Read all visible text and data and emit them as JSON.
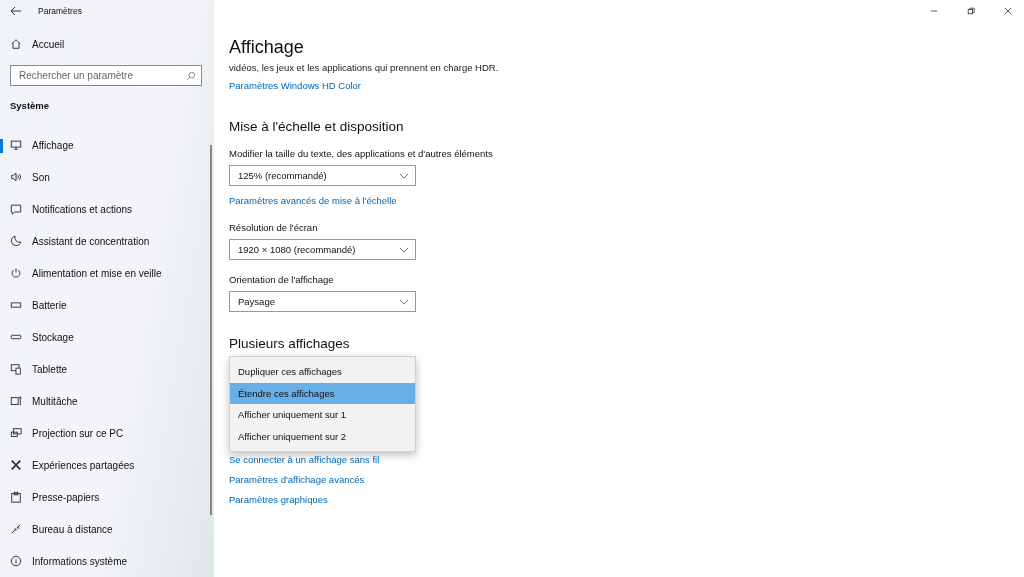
{
  "window": {
    "title": "Paramètres"
  },
  "sidebar": {
    "home": "Accueil",
    "search": {
      "placeholder": "Rechercher un paramètre"
    },
    "section": "Système",
    "items": [
      {
        "label": "Affichage",
        "selected": true
      },
      {
        "label": "Son",
        "selected": false
      },
      {
        "label": "Notifications et actions",
        "selected": false
      },
      {
        "label": "Assistant de concentration",
        "selected": false
      },
      {
        "label": "Alimentation et mise en veille",
        "selected": false
      },
      {
        "label": "Batterie",
        "selected": false
      },
      {
        "label": "Stockage",
        "selected": false
      },
      {
        "label": "Tablette",
        "selected": false
      },
      {
        "label": "Multitâche",
        "selected": false
      },
      {
        "label": "Projection sur ce PC",
        "selected": false
      },
      {
        "label": "Expériences partagées",
        "selected": false
      },
      {
        "label": "Presse-papiers",
        "selected": false
      },
      {
        "label": "Bureau à distance",
        "selected": false
      },
      {
        "label": "Informations système",
        "selected": false
      }
    ]
  },
  "main": {
    "title": "Affichage",
    "hdr_text": "vidéos, les jeux et les applications qui prennent en charge HDR.",
    "hdr_link": "Paramètres Windows HD Color",
    "scale_section": {
      "heading": "Mise à l'échelle et disposition",
      "fields": [
        {
          "label": "Modifier la taille du texte, des applications et d'autres éléments",
          "value": "125% (recommandé)",
          "link": "Paramètres avancés de mise à l'échelle"
        },
        {
          "label": "Résolution de l'écran",
          "value": "1920 × 1080 (recommandé)"
        },
        {
          "label": "Orientation de l'affichage",
          "value": "Paysage"
        }
      ]
    },
    "multi_section": {
      "heading": "Plusieurs affichages",
      "menu": [
        {
          "label": "Dupliquer ces affichages",
          "selected": false
        },
        {
          "label": "Étendre ces affichages",
          "selected": true
        },
        {
          "label": "Afficher uniquement sur 1",
          "selected": false
        },
        {
          "label": "Afficher uniquement sur 2",
          "selected": false
        }
      ],
      "links": [
        "Se connecter à un affichage sans fil",
        "Paramètres d'affichage avancés",
        "Paramètres graphiques"
      ]
    }
  }
}
